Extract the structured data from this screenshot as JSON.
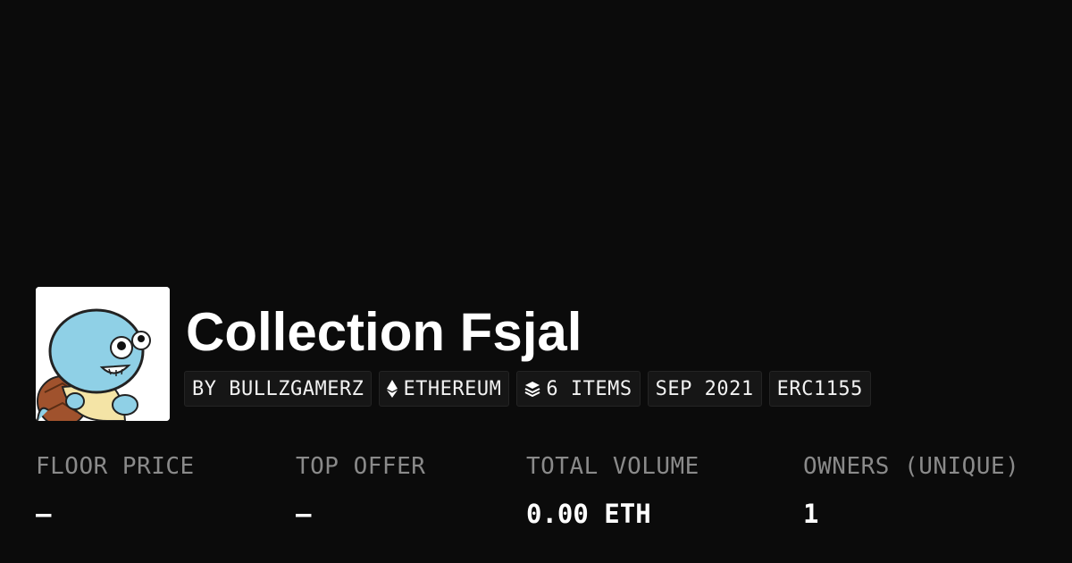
{
  "collection": {
    "title": "Collection Fsjal",
    "avatar_icon": "squirtle-fsjal-avatar"
  },
  "badges": [
    {
      "text": "BY BULLZGAMERZ",
      "icon": null
    },
    {
      "text": "ETHEREUM",
      "icon": "ethereum-icon"
    },
    {
      "text": "6 ITEMS",
      "icon": "layers-icon"
    },
    {
      "text": "SEP 2021",
      "icon": null
    },
    {
      "text": "ERC1155",
      "icon": null
    }
  ],
  "stats": [
    {
      "label": "FLOOR PRICE",
      "value": "—"
    },
    {
      "label": "TOP OFFER",
      "value": "—"
    },
    {
      "label": "TOTAL VOLUME",
      "value": "0.00 ETH"
    },
    {
      "label": "OWNERS (UNIQUE)",
      "value": "1"
    }
  ],
  "colors": {
    "background": "#0b0b0b",
    "label": "#8a8a8a",
    "badge_bg": "#161616"
  }
}
